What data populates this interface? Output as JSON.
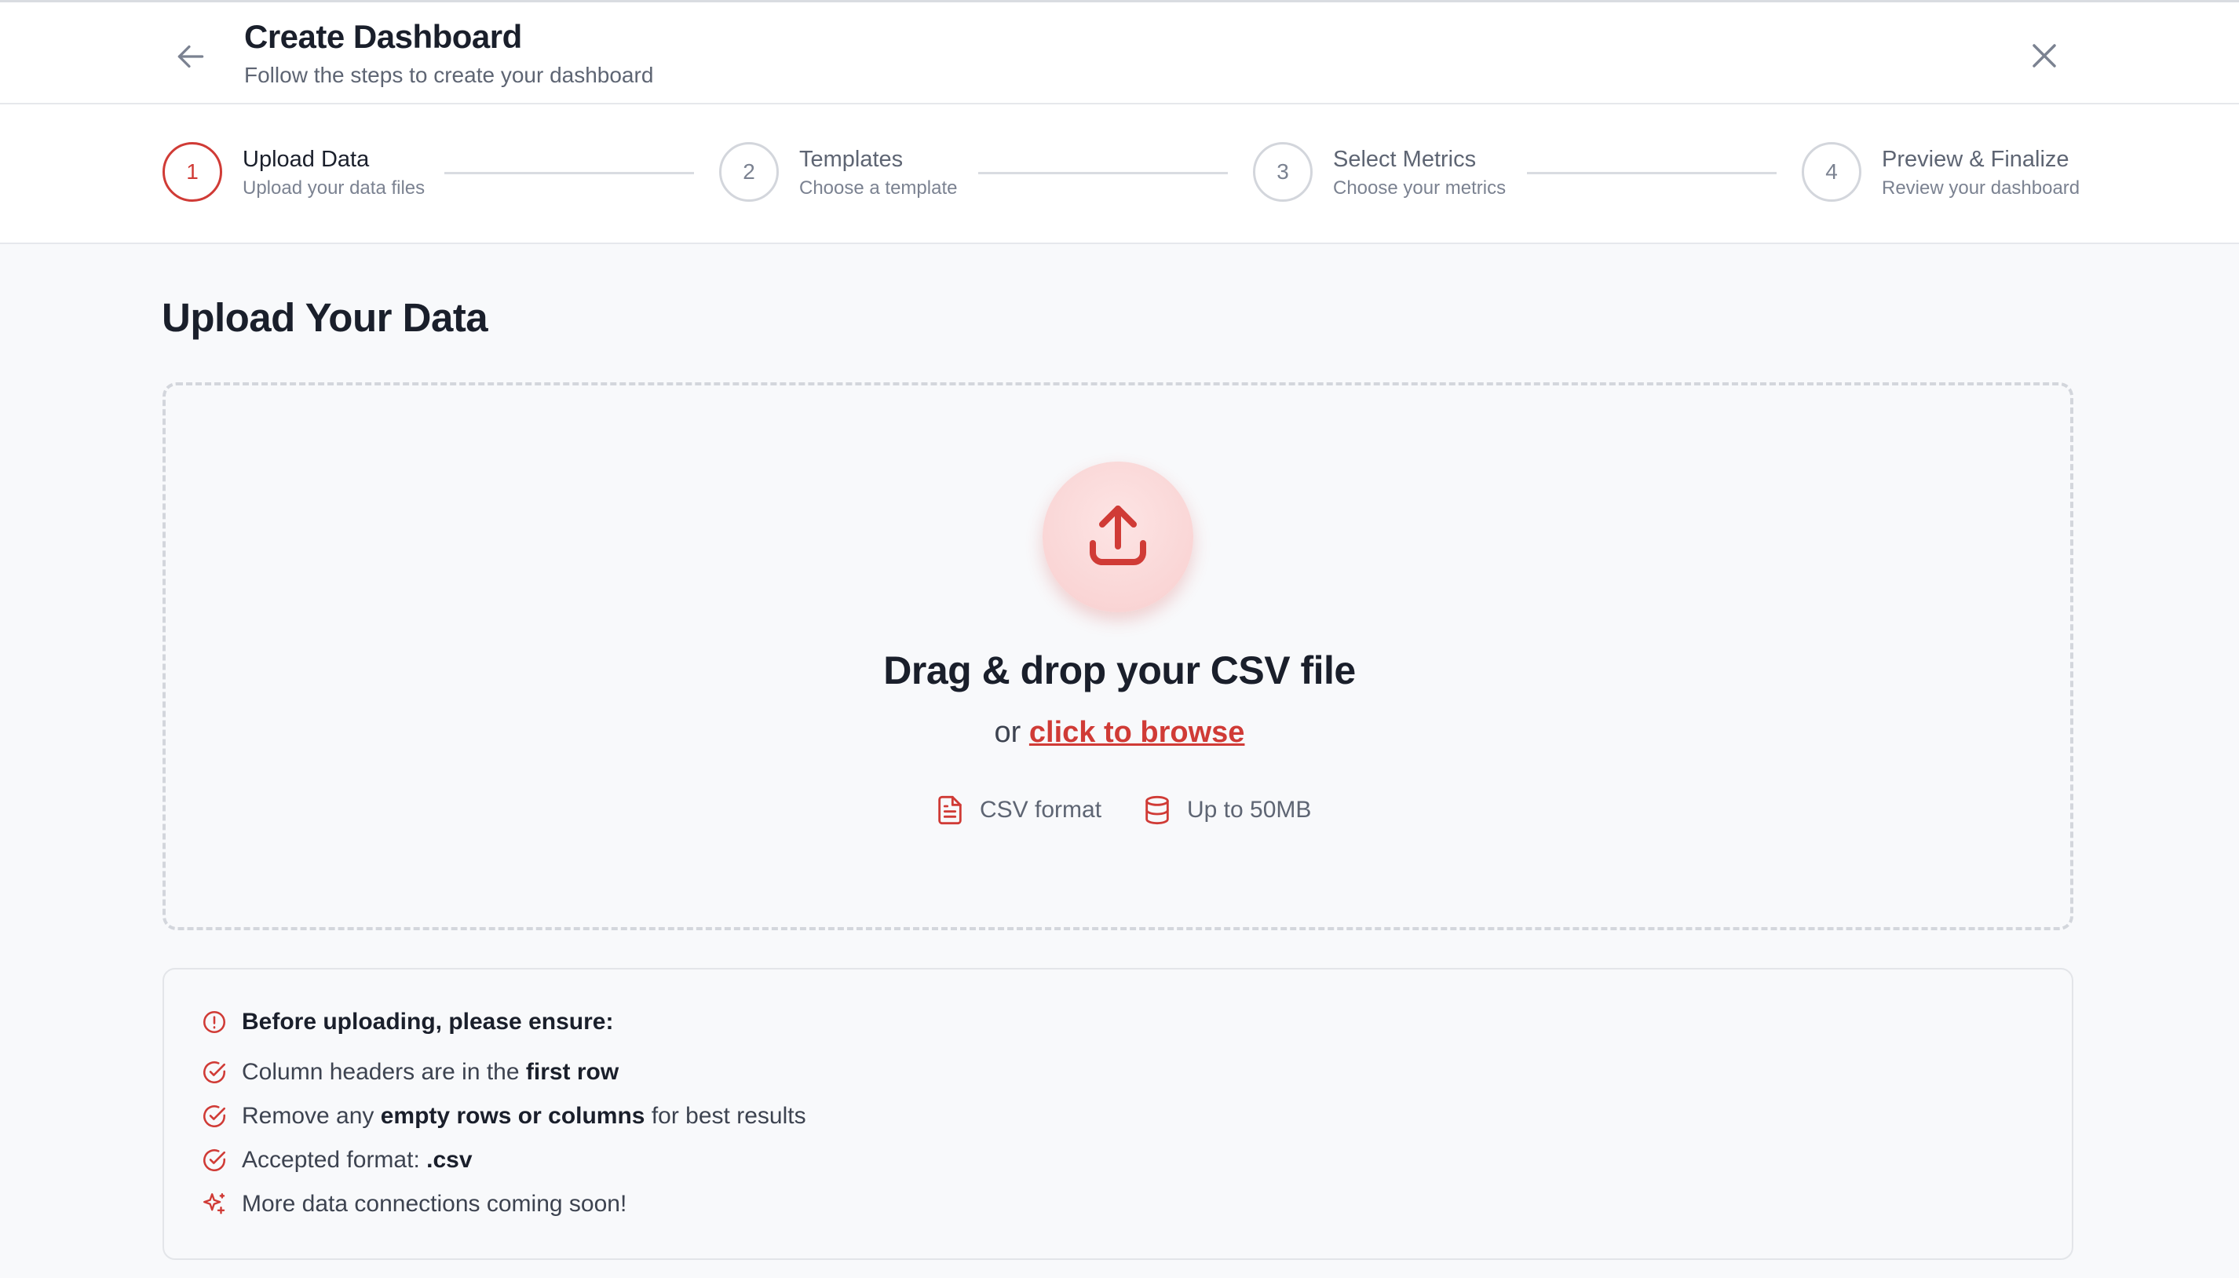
{
  "header": {
    "title": "Create Dashboard",
    "subtitle": "Follow the steps to create your dashboard"
  },
  "steps": [
    {
      "number": "1",
      "title": "Upload Data",
      "subtitle": "Upload your data files",
      "active": true
    },
    {
      "number": "2",
      "title": "Templates",
      "subtitle": "Choose a template",
      "active": false
    },
    {
      "number": "3",
      "title": "Select Metrics",
      "subtitle": "Choose your metrics",
      "active": false
    },
    {
      "number": "4",
      "title": "Preview & Finalize",
      "subtitle": "Review your dashboard",
      "active": false
    }
  ],
  "upload": {
    "section_title": "Upload Your Data",
    "drop_title": "Drag & drop your CSV file",
    "or_text": "or",
    "browse_text": "click to browse",
    "format_label": "CSV format",
    "size_label": "Up to 50MB"
  },
  "notes": {
    "heading": "Before uploading, please ensure:",
    "items": [
      {
        "pre": "Column headers are in the ",
        "bold": "first row",
        "post": ""
      },
      {
        "pre": "Remove any ",
        "bold": "empty rows or columns",
        "post": " for best results"
      },
      {
        "pre": "Accepted format: ",
        "bold": ".csv",
        "post": ""
      },
      {
        "pre": "More data connections coming soon!",
        "bold": "",
        "post": ""
      }
    ]
  },
  "icons": {
    "back": "arrow-left-icon",
    "close": "close-icon",
    "upload": "upload-icon",
    "file": "file-text-icon",
    "database": "database-icon",
    "alert": "alert-circle-icon",
    "check": "check-circle-icon",
    "sparkles": "sparkles-icon"
  },
  "colors": {
    "accent": "#d03b36",
    "text": "#1a1f2b",
    "muted": "#5e6573",
    "background": "#f8f9fb"
  }
}
